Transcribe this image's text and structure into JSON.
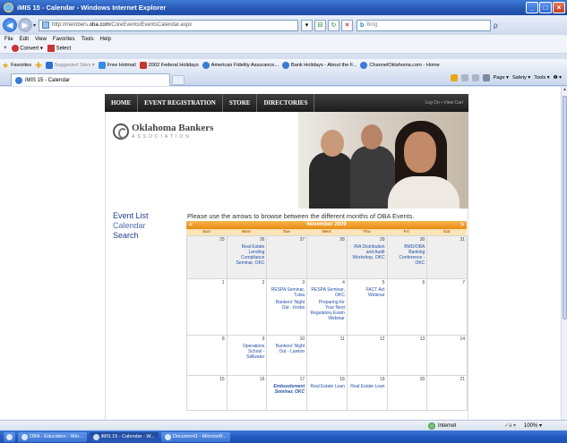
{
  "window": {
    "title": "iMIS 15 - Calendar - Windows Internet Explorer",
    "minimize": "_",
    "maximize": "□",
    "close": "×"
  },
  "nav": {
    "back": "◀",
    "forward": "▶",
    "dropdown": "▾",
    "address_prefix": "http://members.",
    "address_domain": "oba.com",
    "address_rest": "/CoreEvents/EventsCalendar.aspx",
    "search_placeholder": "Bing",
    "search_brand": "b",
    "search_button": "ρ"
  },
  "menu": [
    "File",
    "Edit",
    "View",
    "Favorites",
    "Tools",
    "Help"
  ],
  "toolbar": {
    "close": "×",
    "convert": "Convert",
    "select": "Select"
  },
  "favorites": {
    "label": "Favorites",
    "items": [
      "Suggested Sites ▾",
      "Free Hotmail",
      "2002 Federal Holidays",
      "American Fidelity Assurance...",
      "Bank Holidays - About the F...",
      "ChannelOklahoma.com - Home"
    ]
  },
  "tab": {
    "label": "iMIS 15 - Calendar"
  },
  "command_bar": {
    "page": "Page ▾",
    "safety": "Safety ▾",
    "tools": "Tools ▾",
    "help": "❷ ▾"
  },
  "site": {
    "nav": [
      "HOME",
      "EVENT REGISTRATION",
      "STORE",
      "DIRECTORIES"
    ],
    "logon": "Log On ▪ View Cart",
    "logo_name": "Oklahoma Bankers",
    "logo_assoc": "ASSOCIATION",
    "sidenav": [
      "Event List",
      "Calendar",
      "Search"
    ],
    "intro": "Please use the arrows to browse between the different months of OBA Events."
  },
  "calendar": {
    "month": "November 2009",
    "prev": "<",
    "next": ">",
    "days": [
      "Sun",
      "Mon",
      "Tue",
      "Wed",
      "Thu",
      "Fri",
      "Sat"
    ],
    "weeks": [
      [
        {
          "d": "25",
          "shade": true,
          "ev": []
        },
        {
          "d": "26",
          "shade": true,
          "ev": [
            {
              "t": "Real Estate Lending Compliance Seminar, OKC"
            }
          ]
        },
        {
          "d": "27",
          "shade": true,
          "ev": []
        },
        {
          "d": "28",
          "shade": true,
          "ev": []
        },
        {
          "d": "29",
          "shade": true,
          "ev": [
            {
              "t": "IRA Distribution and Audit Workshop, OKC"
            }
          ]
        },
        {
          "d": "30",
          "shade": true,
          "ev": [
            {
              "t": "BMD/OBA Banking Conference - OKC"
            }
          ]
        },
        {
          "d": "31",
          "shade": true,
          "ev": []
        }
      ],
      [
        {
          "d": "1",
          "ev": []
        },
        {
          "d": "2",
          "ev": []
        },
        {
          "d": "3",
          "ev": [
            {
              "t": "RESPA Seminar, Tulsa"
            },
            {
              "t": "Bankers' Night Out - Krebs"
            }
          ]
        },
        {
          "d": "4",
          "ev": [
            {
              "t": "RESPA Seminar, OKC"
            },
            {
              "t": "Preparing for Your Next Regulatory Exam Webinar"
            }
          ]
        },
        {
          "d": "5",
          "ev": [
            {
              "t": "FACT Act Webinar"
            }
          ]
        },
        {
          "d": "6",
          "ev": []
        },
        {
          "d": "7",
          "ev": []
        }
      ],
      [
        {
          "d": "8",
          "ev": []
        },
        {
          "d": "9",
          "ev": [
            {
              "t": "Operations School - Stillwater"
            }
          ]
        },
        {
          "d": "10",
          "ev": [
            {
              "t": "Bankers' Night Out - Lawton"
            }
          ]
        },
        {
          "d": "11",
          "ev": []
        },
        {
          "d": "12",
          "ev": []
        },
        {
          "d": "13",
          "ev": []
        },
        {
          "d": "14",
          "ev": []
        }
      ],
      [
        {
          "d": "15",
          "ev": []
        },
        {
          "d": "16",
          "ev": []
        },
        {
          "d": "17",
          "ev": [
            {
              "t": "Embezzlement Seminar, OKC",
              "em": true
            }
          ]
        },
        {
          "d": "18",
          "ev": [
            {
              "t": "Real Estate Loan"
            }
          ]
        },
        {
          "d": "19",
          "ev": [
            {
              "t": "Real Estate Loan"
            }
          ]
        },
        {
          "d": "20",
          "ev": []
        },
        {
          "d": "21",
          "ev": []
        }
      ]
    ]
  },
  "status": {
    "zone": "Internet",
    "misc": "✓a ▾",
    "zoom": "100% ▾"
  },
  "taskbar": [
    {
      "label": "OBA - Education - Win...",
      "active": false
    },
    {
      "label": "iMIS 15 - Calendar - W...",
      "active": true
    },
    {
      "label": "Document1 - Microsoft...",
      "active": false
    }
  ]
}
